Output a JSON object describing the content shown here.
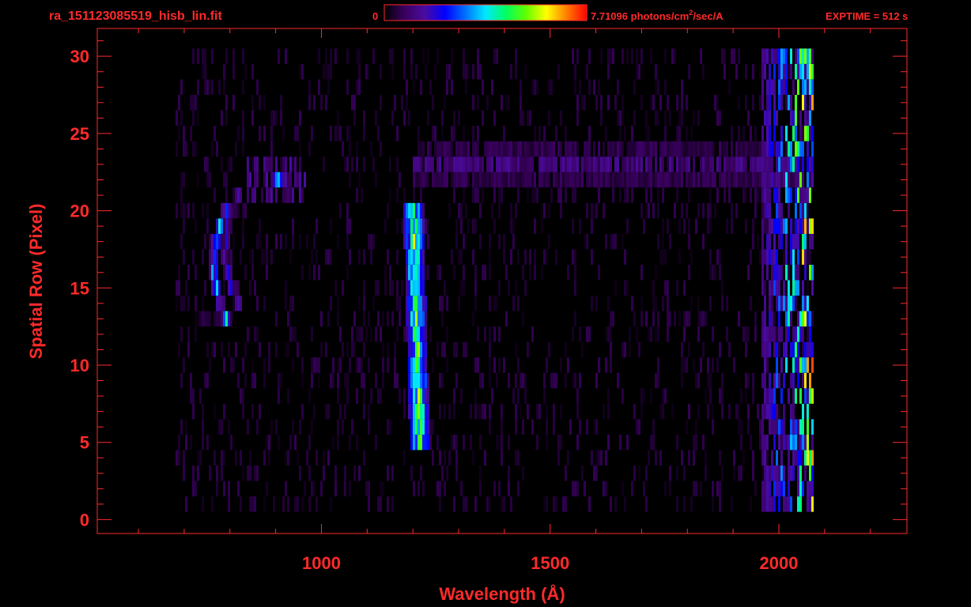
{
  "header": {
    "filename": "ra_151123085519_hisb_lin.fit",
    "colorbar_min": "0",
    "colorbar_max_value": "7.71096",
    "colorbar_units_pre": "photons/cm",
    "colorbar_units_exp": "2",
    "colorbar_units_post": "/sec/A",
    "exptime": "EXPTIME = 512 s"
  },
  "colors": {
    "background": "#000000",
    "axis": "#ff2a2a",
    "colormap": [
      "#000000",
      "#3a0060",
      "#4a0ca0",
      "#0000ff",
      "#0070ff",
      "#00e8ff",
      "#00ff60",
      "#60ff00",
      "#ffff00",
      "#ff8000",
      "#ff0000"
    ]
  },
  "chart_data": {
    "type": "heatmap",
    "xlabel": "Wavelength (Å)",
    "ylabel": "Spatial Row (Pixel)",
    "xlim": [
      510,
      2280
    ],
    "ylim": [
      -0.9,
      31.8
    ],
    "x_ticks": [
      1000,
      1500,
      2000
    ],
    "x_tick_labels": [
      "1000",
      "1500",
      "2000"
    ],
    "y_ticks": [
      0,
      5,
      10,
      15,
      20,
      25,
      30
    ],
    "y_tick_labels": [
      "0",
      "5",
      "10",
      "15",
      "20",
      "25",
      "30"
    ],
    "x_minor_step": 100,
    "y_minor_step": 1,
    "value_range": [
      0,
      7.71096
    ],
    "grid": false,
    "rows_covered": [
      1,
      30
    ],
    "wavelength_range_covered": [
      680,
      2075
    ],
    "features": [
      {
        "kind": "vertical_line",
        "x": 1215,
        "rows": [
          5,
          20
        ],
        "intensity_range": [
          3.2,
          6.5
        ]
      },
      {
        "kind": "arc",
        "x_center": 765,
        "rows": [
          13,
          20
        ],
        "intensity_range": [
          1.5,
          5.0
        ]
      },
      {
        "kind": "arc",
        "x_center": 790,
        "rows": [
          14,
          21
        ],
        "intensity_range": [
          0.8,
          2.6
        ]
      },
      {
        "kind": "blob",
        "x": 905,
        "row": 22,
        "intensity": 3.9
      },
      {
        "kind": "horizontal_band",
        "rows": [
          22,
          24
        ],
        "x_range": [
          1200,
          2040
        ],
        "intensity_range": [
          0.6,
          1.5
        ]
      },
      {
        "kind": "edge_band",
        "x_range": [
          1960,
          2075
        ],
        "rows": [
          1,
          30
        ],
        "intensity_range": [
          1.0,
          7.7
        ]
      }
    ]
  }
}
